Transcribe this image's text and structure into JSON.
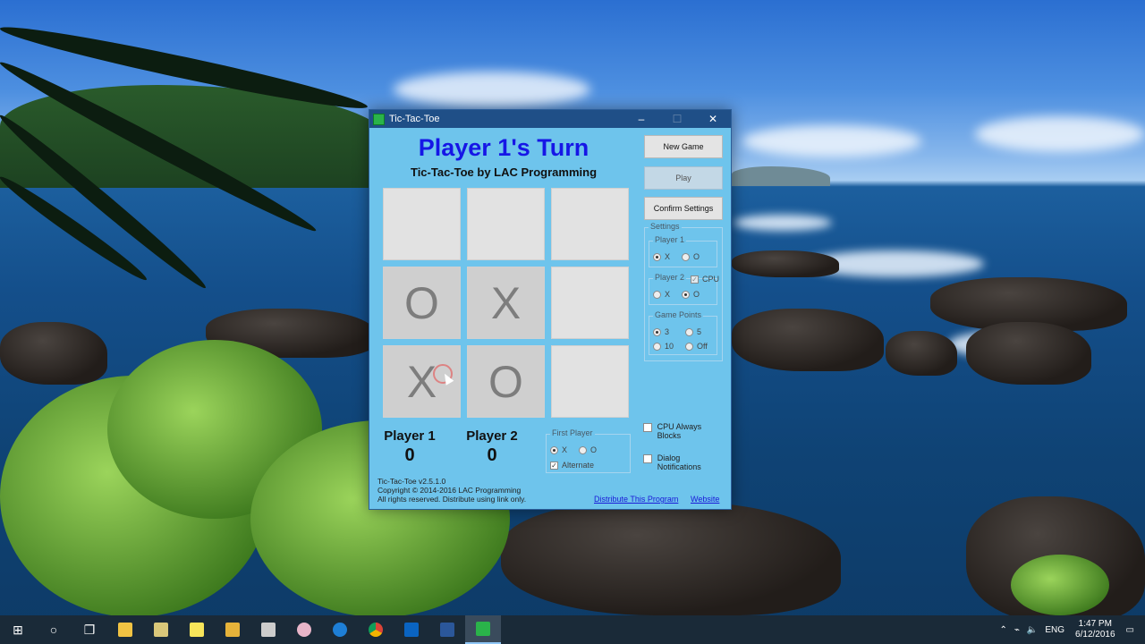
{
  "window": {
    "title": "Tic-Tac-Toe",
    "controls": {
      "minimize": "–",
      "maximize": "☐",
      "close": "✕"
    }
  },
  "game": {
    "turn_text": "Player 1's Turn",
    "subtitle": "Tic-Tac-Toe by LAC Programming",
    "board": [
      "",
      "",
      "",
      "O",
      "X",
      "",
      "X",
      "O",
      ""
    ]
  },
  "buttons": {
    "new_game": "New Game",
    "play": "Play",
    "confirm_settings": "Confirm Settings"
  },
  "settings": {
    "label": "Settings",
    "player1": {
      "label": "Player 1",
      "x": "X",
      "o": "O"
    },
    "player2": {
      "label": "Player 2",
      "cpu": "CPU",
      "x": "X",
      "o": "O"
    },
    "game_points": {
      "label": "Game Points",
      "opt1": "3",
      "opt2": "5",
      "opt3": "10",
      "opt4": "Off"
    }
  },
  "scores": {
    "p1_name": "Player 1",
    "p1_score": "0",
    "p2_name": "Player 2",
    "p2_score": "0"
  },
  "first_player": {
    "label": "First Player",
    "x": "X",
    "o": "O",
    "alternate": "Alternate"
  },
  "options": {
    "cpu_always_blocks": "CPU Always Blocks",
    "dialog_notifications": "Dialog Notifications"
  },
  "info": {
    "version": "Tic-Tac-Toe v2.5.1.0",
    "copyright": "Copyright © 2014-2016 LAC Programming",
    "rights": "All rights reserved. Distribute using link only."
  },
  "links": {
    "distribute": "Distribute This Program",
    "website": "Website"
  },
  "taskbar": {
    "language": "ENG",
    "time": "1:47 PM",
    "date": "6/12/2016"
  },
  "colors": {
    "window_bg": "#6ec4ec",
    "turn_text": "#1616e6",
    "titlebar": "#1f4f87",
    "taskbar": "#1a2a38"
  }
}
